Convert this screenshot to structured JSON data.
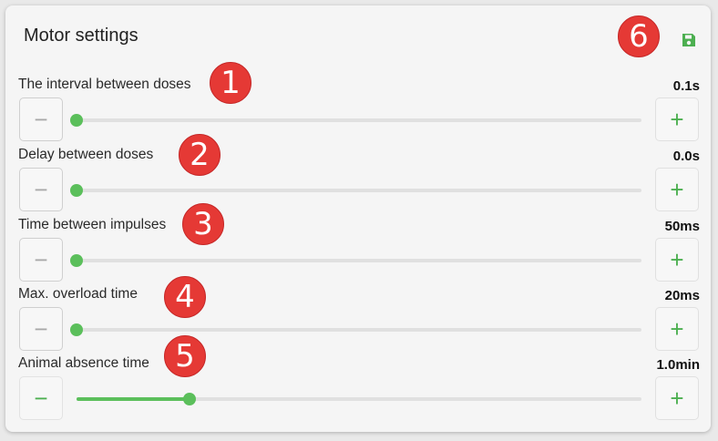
{
  "panel": {
    "title": "Motor settings",
    "save_icon": "save-icon",
    "save_badge": "6"
  },
  "settings": [
    {
      "label": "The interval between doses",
      "value": "0.1s",
      "level": 0.0,
      "badge": "1",
      "minus_icon": "minus-icon",
      "plus_icon": "plus-icon"
    },
    {
      "label": "Delay between doses",
      "value": "0.0s",
      "level": 0.0,
      "badge": "2",
      "minus_icon": "minus-icon",
      "plus_icon": "plus-icon"
    },
    {
      "label": "Time between impulses",
      "value": "50ms",
      "level": 0.0,
      "badge": "3",
      "minus_icon": "minus-icon",
      "plus_icon": "plus-icon"
    },
    {
      "label": "Max. overload time",
      "value": "20ms",
      "level": 0.0,
      "badge": "4",
      "minus_icon": "minus-icon",
      "plus_icon": "plus-icon"
    },
    {
      "label": "Animal absence time",
      "value": "1.0min",
      "level": 0.2,
      "badge": "5",
      "minus_icon": "minus-icon",
      "plus_icon": "plus-icon"
    }
  ],
  "colors": {
    "accent": "#5bbf5b",
    "badge": "#e53935",
    "track": "#e0e0e0"
  },
  "symbols": {
    "minus": "−",
    "plus": "+"
  }
}
